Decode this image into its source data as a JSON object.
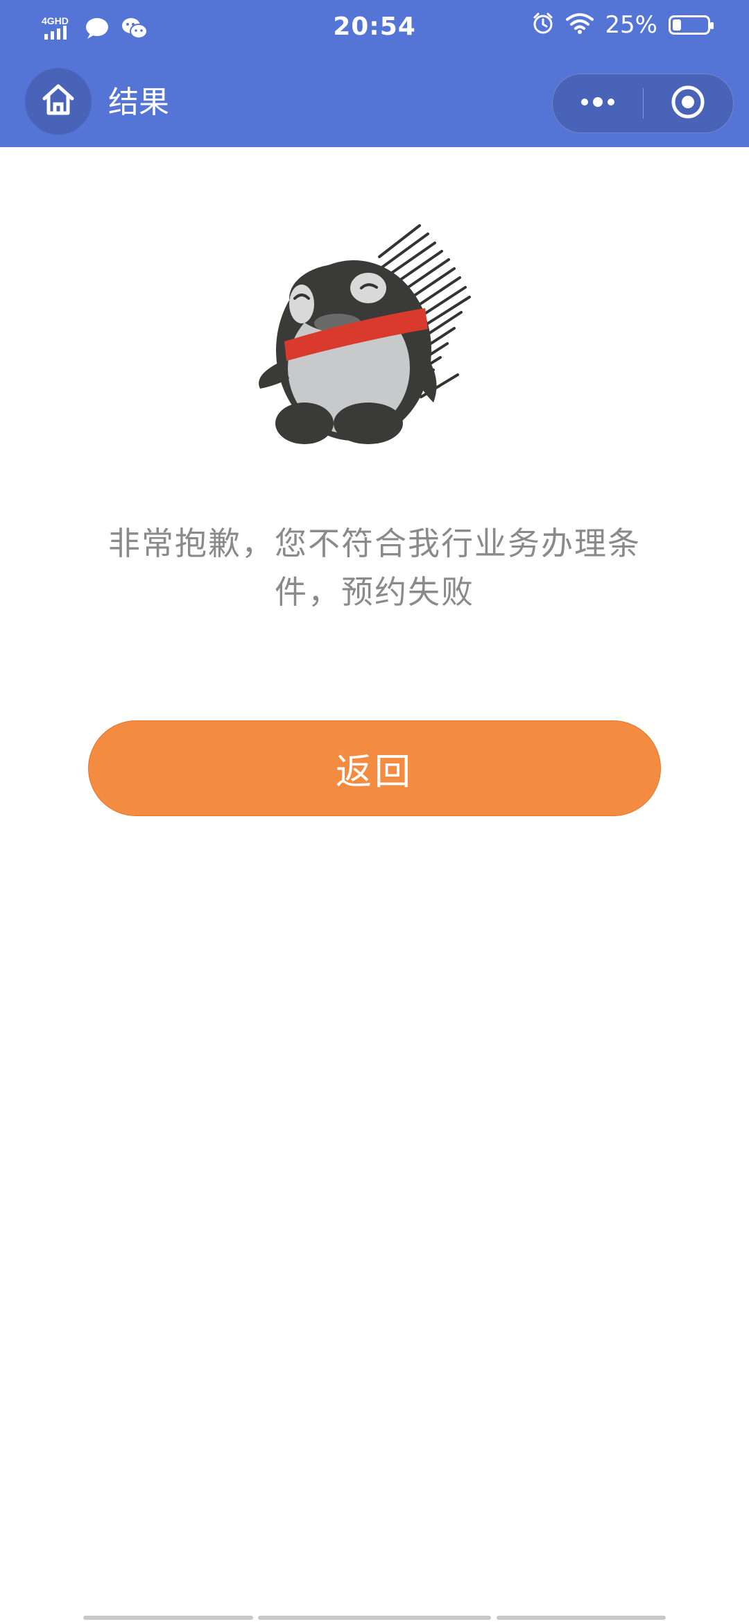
{
  "status_bar": {
    "time": "20:54",
    "network": "4GHD",
    "battery_percent": "25%",
    "battery_level": 0.25,
    "icons": [
      "signal-icon",
      "chat-bubble-icon",
      "wechat-icon",
      "alarm-icon",
      "wifi-icon",
      "battery-icon"
    ]
  },
  "nav": {
    "title": "结果",
    "home_icon": "home-icon",
    "menu_icon": "more-icon",
    "close_icon": "target-icon"
  },
  "content": {
    "message": "非常抱歉，您不符合我行业务办理条件，预约失败",
    "button_label": "返回",
    "illustration": "penguin-illustration"
  },
  "colors": {
    "header": "#5474D6",
    "button": "#F38C40",
    "text_muted": "#8a8a8a",
    "scarf": "#D93A2B"
  }
}
